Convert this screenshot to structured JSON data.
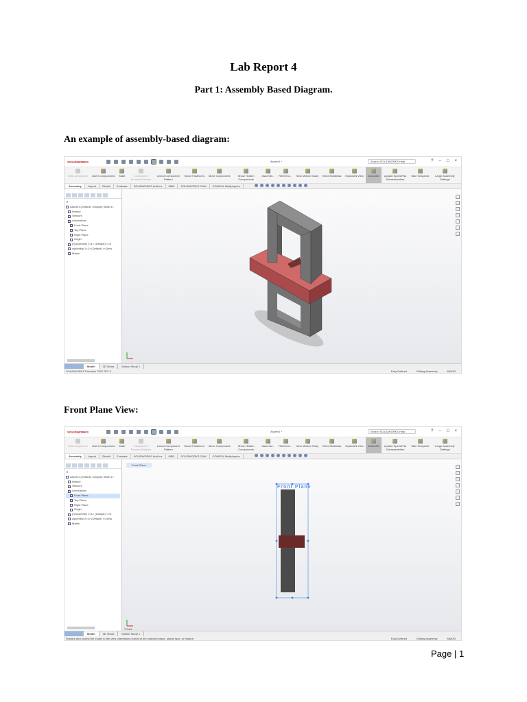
{
  "doc": {
    "title": "Lab Report 4",
    "subtitle": "Part 1: Assembly Based Diagram.",
    "heading1": "An example of assembly-based diagram:",
    "heading2": "Front Plane View:",
    "page": "Page | 1"
  },
  "shots": [
    {
      "app": "SOLIDWORKS",
      "title": "Assem1 *",
      "search": "Search SOLIDWORKS Help",
      "ribbon": [
        "Edit Component",
        "Insert Components",
        "Mate",
        "Component Preview Window",
        "Linear Component Pattern",
        "Smart Fasteners",
        "Move Component",
        "Show Hidden Components",
        "Assembl...",
        "Referenc...",
        "New Motion Study",
        "Bill of Materials",
        "Exploded View",
        "Instant3D",
        "Update SpeedPak Subassemblies",
        "Take Snapshot",
        "Large Assembly Settings"
      ],
      "tabs": [
        "Assembly",
        "Layout",
        "Sketch",
        "Evaluate",
        "SOLIDWORKS Add-Ins",
        "MBD",
        "SOLIDWORKS CAM",
        "COMSOL Multiphysics"
      ],
      "tree": [
        "Assem1 (Default) <Display State-1>",
        "History",
        "Sensors",
        "Annotations",
        "Front Plane",
        "Top Plane",
        "Right Plane",
        "Origin",
        "(f) Assembly 1<1> (Default) <<D",
        "assembly 2<2> (Default) <<Defa",
        "Mates"
      ],
      "bottom_tabs": [
        "Model",
        "3D Views",
        "Motion Study 1"
      ],
      "status": "SOLIDWORKS Premium 2022 SP1.0",
      "status_right": [
        "Fully Defined",
        "Editing Assembly",
        "MMGS"
      ]
    },
    {
      "app": "SOLIDWORKS",
      "title": "Assem1 *",
      "search": "Search SOLIDWORKS Help",
      "ribbon": [
        "Edit Component",
        "Insert Components",
        "Mate",
        "Component Preview Window",
        "Linear Component Pattern",
        "Smart Fasteners",
        "Move Component",
        "Show Hidden Components",
        "Assembl...",
        "Referenc...",
        "New Motion Study",
        "Bill of Materials",
        "Exploded View",
        "Instant3D",
        "Update SpeedPak Subassemblies",
        "Take Snapshot",
        "Large Assembly Settings"
      ],
      "tabs": [
        "Assembly",
        "Layout",
        "Sketch",
        "Evaluate",
        "SOLIDWORKS Add-Ins",
        "MBD",
        "SOLIDWORKS CAM",
        "COMSOL Multiphysics"
      ],
      "tree": [
        "Assem1 (Default) <Display State-1>",
        "History",
        "Sensors",
        "Annotations",
        "Front Plane",
        "Top Plane",
        "Right Plane",
        "Origin",
        "(f) Assembly 1<1> (Default) <<D",
        "assembly 2<2> (Default) <<Defa",
        "Mates"
      ],
      "bottom_tabs": [
        "Model",
        "3D Views",
        "Motion Study 1"
      ],
      "status": "Rotates and zooms the model to the view orientation normal to the selected plane, planar face, or feature.",
      "status_right": [
        "Fully Defined",
        "Editing Assembly",
        "MMGS"
      ],
      "breadcrumb": "Front Plane",
      "plane_label": "Front Plane",
      "view_label": "*Front",
      "selected_tree_index": 4
    }
  ],
  "colors": {
    "part_gray": "#6f6f6f",
    "part_red": "#c0595a",
    "selection": "#4a90e2"
  }
}
